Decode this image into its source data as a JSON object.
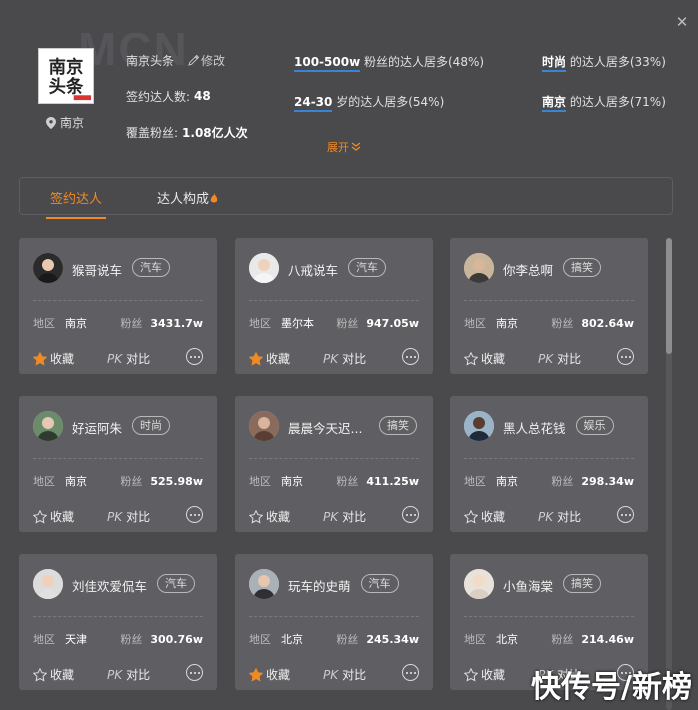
{
  "watermark_bg": "MCN",
  "org": {
    "name": "南京头条",
    "edit_label": "修改",
    "city": "南京",
    "signed_label": "签约达人数:",
    "signed_value": "48",
    "fans_label": "覆盖粉丝:",
    "fans_value": "1.08亿人次",
    "logo_text_1": "南京",
    "logo_text_2": "头条"
  },
  "stats": [
    {
      "hl": "100-500w",
      "rest": "粉丝的达人居多(48%)"
    },
    {
      "hl": "24-30",
      "rest": "岁的达人居多(54%)"
    },
    {
      "hl": "时尚",
      "rest": "的达人居多(33%)"
    },
    {
      "hl": "南京",
      "rest": "的达人居多(71%)"
    }
  ],
  "expand_label": "展开",
  "tabs": [
    {
      "label": "签约达人"
    },
    {
      "label": "达人构成"
    }
  ],
  "card_labels": {
    "region": "地区",
    "fans": "粉丝",
    "favorite": "收藏",
    "pk": "PK",
    "compare": "对比"
  },
  "cards": [
    {
      "name": "猴哥说车",
      "tag": "汽车",
      "region": "南京",
      "fans": "3431.7w",
      "favorited": true
    },
    {
      "name": "八戒说车",
      "tag": "汽车",
      "region": "墨尔本",
      "fans": "947.05w",
      "favorited": true
    },
    {
      "name": "你李总啊",
      "tag": "搞笑",
      "region": "南京",
      "fans": "802.64w",
      "favorited": false
    },
    {
      "name": "好运阿朱",
      "tag": "时尚",
      "region": "南京",
      "fans": "525.98w",
      "favorited": false
    },
    {
      "name": "晨晨今天迟...",
      "tag": "搞笑",
      "region": "南京",
      "fans": "411.25w",
      "favorited": false
    },
    {
      "name": "黑人总花钱",
      "tag": "娱乐",
      "region": "南京",
      "fans": "298.34w",
      "favorited": false
    },
    {
      "name": "刘佳欢爱侃车",
      "tag": "汽车",
      "region": "天津",
      "fans": "300.76w",
      "favorited": false
    },
    {
      "name": "玩车的史萌",
      "tag": "汽车",
      "region": "北京",
      "fans": "245.34w",
      "favorited": true
    },
    {
      "name": "小鱼海棠",
      "tag": "搞笑",
      "region": "北京",
      "fans": "214.46w",
      "favorited": false
    }
  ],
  "brand_watermark": "快传号/新榜",
  "colors": {
    "accent": "#f08a24",
    "underline": "#3a84d6",
    "background": "#4a4a4d",
    "card": "#5f5f63"
  }
}
